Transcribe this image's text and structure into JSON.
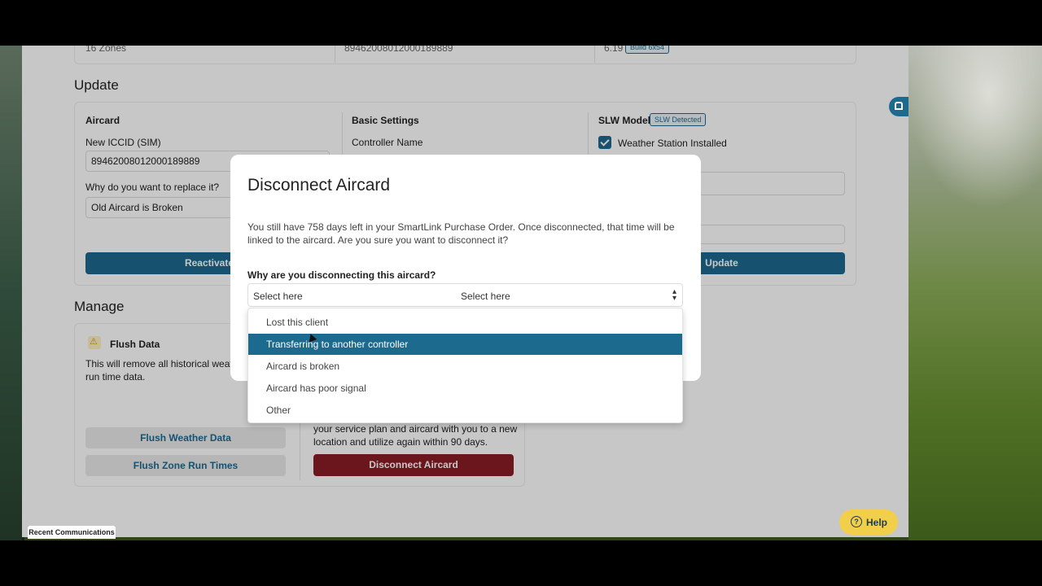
{
  "top_row": {
    "zones": "16 Zones",
    "iccid": "89462008012000189889",
    "version": "6.19",
    "build_badge": "Build 6x54"
  },
  "update": {
    "title": "Update",
    "aircard": {
      "heading": "Aircard",
      "iccid_label": "New ICCID (SIM)",
      "iccid_value": "89462008012000189889",
      "reason_label": "Why do you want to replace it?",
      "reason_value": "Old Aircard is Broken",
      "reactivate_button": "Reactivate"
    },
    "basic_settings": {
      "heading": "Basic Settings",
      "controller_name_label": "Controller Name"
    },
    "slw": {
      "heading": "SLW Model",
      "badge": "SLW Detected",
      "weather_station_label": "Weather Station Installed",
      "weather_station_checked": true,
      "update_button": "Update"
    }
  },
  "manage": {
    "title": "Manage",
    "flush": {
      "heading": "Flush Data",
      "description": "This will remove all historical weathe",
      "description2": "run time data.",
      "flush_weather_button": "Flush Weather Data",
      "flush_zone_button": "Flush Zone Run Times"
    },
    "disconnect": {
      "description1": "your service plan and aircard with you to a new",
      "description2": "location and utilize again within 90 days.",
      "disconnect_button": "Disconnect Aircard"
    }
  },
  "modal": {
    "title": "Disconnect Aircard",
    "body": "You still have 758 days left in your SmartLink Purchase Order. Once disconnected, that time will be linked to the aircard. Are you sure you want to disconnect it?",
    "question": "Why are you disconnecting this aircard?",
    "select_placeholder": "Select here",
    "select_value": "Select here",
    "options": [
      "Lost this client",
      "Transferring to another controller",
      "Aircard is broken",
      "Aircard has poor signal",
      "Other"
    ],
    "highlighted_option_index": 1
  },
  "help_button": "Help",
  "recent_communications": "Recent Communications",
  "colors": {
    "primary": "#1d6a8f",
    "danger": "#8a1c26",
    "help": "#f2cf4a"
  }
}
